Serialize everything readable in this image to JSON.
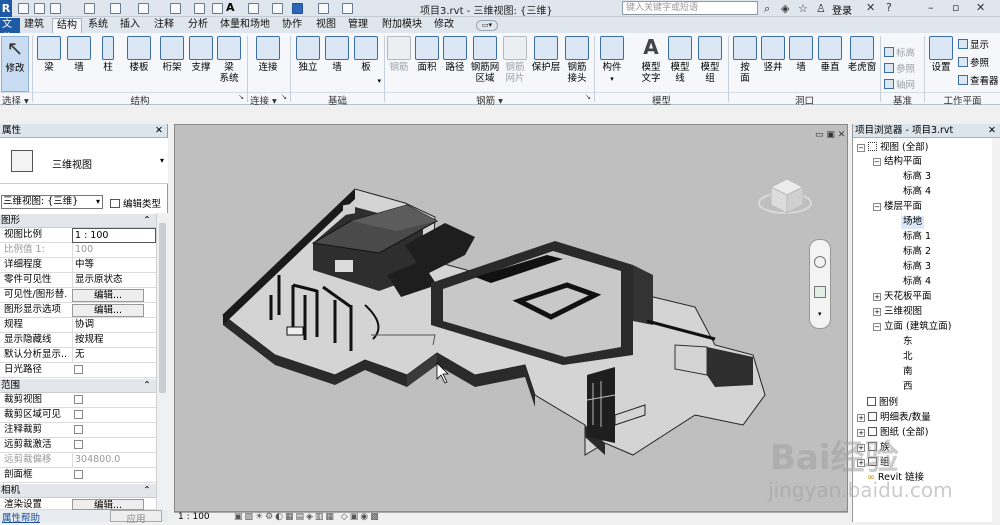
{
  "window": {
    "title": "项目3.rvt - 三维视图: {三维}",
    "search_placeholder": "键入关键字或短语",
    "login": "登录"
  },
  "tabs": [
    {
      "label": "文件"
    },
    {
      "label": "建筑"
    },
    {
      "label": "结构"
    },
    {
      "label": "系统"
    },
    {
      "label": "插入"
    },
    {
      "label": "注释"
    },
    {
      "label": "分析"
    },
    {
      "label": "体量和场地"
    },
    {
      "label": "协作"
    },
    {
      "label": "视图"
    },
    {
      "label": "管理"
    },
    {
      "label": "附加模块"
    },
    {
      "label": "修改"
    }
  ],
  "ribbon": {
    "buttons": [
      {
        "label": "修改",
        "icon": "cursor-arrow-icon"
      },
      {
        "label": "梁",
        "icon": "beam-icon"
      },
      {
        "label": "墙",
        "icon": "wall-icon"
      },
      {
        "label": "柱",
        "icon": "column-icon"
      },
      {
        "label": "楼板",
        "icon": "floor-icon"
      },
      {
        "label": "桁架",
        "icon": "truss-icon"
      },
      {
        "label": "支撑",
        "icon": "brace-icon"
      },
      {
        "label": "梁\n系统",
        "icon": "beam-system-icon"
      },
      {
        "label": "连接",
        "icon": "connection-icon"
      },
      {
        "label": "独立",
        "icon": "isolated-foundation-icon"
      },
      {
        "label": "墙",
        "icon": "wall-foundation-icon"
      },
      {
        "label": "板",
        "icon": "slab-foundation-icon"
      },
      {
        "label": "钢筋",
        "icon": "rebar-icon"
      },
      {
        "label": "面积",
        "icon": "area-rebar-icon"
      },
      {
        "label": "路径",
        "icon": "path-rebar-icon"
      },
      {
        "label": "钢筋网\n区域",
        "icon": "fabric-area-icon"
      },
      {
        "label": "钢筋\n网片",
        "icon": "fabric-sheet-icon"
      },
      {
        "label": "保护层",
        "icon": "cover-icon"
      },
      {
        "label": "钢筋\n接头",
        "icon": "rebar-coupler-icon"
      },
      {
        "label": "构件",
        "icon": "component-icon"
      },
      {
        "label": "模型\n文字",
        "icon": "model-text-icon"
      },
      {
        "label": "模型\n线",
        "icon": "model-line-icon"
      },
      {
        "label": "模型\n组",
        "icon": "model-group-icon"
      },
      {
        "label": "按\n面",
        "icon": "by-face-icon"
      },
      {
        "label": "竖井",
        "icon": "shaft-icon"
      },
      {
        "label": "墙",
        "icon": "wall-opening-icon"
      },
      {
        "label": "垂直",
        "icon": "vertical-opening-icon"
      },
      {
        "label": "老虎窗",
        "icon": "dormer-icon"
      },
      {
        "label": "设置",
        "icon": "set-workplane-icon"
      }
    ],
    "small": [
      {
        "label": "标高",
        "icon": "level-icon"
      },
      {
        "label": "参照",
        "icon": "reference-plane-icon"
      },
      {
        "label": "轴网",
        "icon": "grid-icon"
      },
      {
        "label": "显示",
        "icon": "show-icon"
      },
      {
        "label": "参照",
        "icon": "ref-plane-icon"
      },
      {
        "label": "查看器",
        "icon": "viewer-icon"
      }
    ],
    "groups": [
      {
        "label": "选择"
      },
      {
        "label": "结构"
      },
      {
        "label": "连接"
      },
      {
        "label": "基础"
      },
      {
        "label": "钢筋"
      },
      {
        "label": "模型"
      },
      {
        "label": "洞口"
      },
      {
        "label": "基准"
      },
      {
        "label": "工作平面"
      }
    ]
  },
  "properties": {
    "header": "属性",
    "type_name": "三维视图",
    "selector": "三维视图: {三维}",
    "edit_type": "编辑类型",
    "categories": [
      {
        "label": "图形",
        "toggle": "⌃"
      },
      {
        "label": "范围",
        "toggle": "⌃"
      },
      {
        "label": "相机",
        "toggle": "⌃"
      }
    ],
    "rows": [
      {
        "key": "视图比例",
        "value": "1 : 100"
      },
      {
        "key": "比例值 1:",
        "value": "100"
      },
      {
        "key": "详细程度",
        "value": "中等"
      },
      {
        "key": "零件可见性",
        "value": "显示原状态"
      },
      {
        "key": "可见性/图形替...",
        "value": "编辑..."
      },
      {
        "key": "图形显示选项",
        "value": "编辑..."
      },
      {
        "key": "规程",
        "value": "协调"
      },
      {
        "key": "显示隐藏线",
        "value": "按规程"
      },
      {
        "key": "默认分析显示...",
        "value": "无"
      },
      {
        "key": "日光路径",
        "value": ""
      },
      {
        "key": "裁剪视图",
        "value": ""
      },
      {
        "key": "裁剪区域可见",
        "value": ""
      },
      {
        "key": "注释裁剪",
        "value": ""
      },
      {
        "key": "远剪裁激活",
        "value": ""
      },
      {
        "key": "远剪裁偏移",
        "value": "304800.0"
      },
      {
        "key": "剖面框",
        "value": ""
      },
      {
        "key": "渲染设置",
        "value": "编辑..."
      }
    ],
    "footer_help": "属性帮助",
    "footer_apply": "应用"
  },
  "view": {
    "scale": "1 : 100"
  },
  "browser": {
    "header": "项目浏览器 - 项目3.rvt",
    "nodes": [
      {
        "label": "视图 (全部)"
      },
      {
        "label": "结构平面"
      },
      {
        "label": "标高 3"
      },
      {
        "label": "标高 4"
      },
      {
        "label": "楼层平面"
      },
      {
        "label": "场地"
      },
      {
        "label": "标高 1"
      },
      {
        "label": "标高 2"
      },
      {
        "label": "标高 3"
      },
      {
        "label": "标高 4"
      },
      {
        "label": "天花板平面"
      },
      {
        "label": "三维视图"
      },
      {
        "label": "立面 (建筑立面)"
      },
      {
        "label": "东"
      },
      {
        "label": "北"
      },
      {
        "label": "南"
      },
      {
        "label": "西"
      },
      {
        "label": "图例"
      },
      {
        "label": "明细表/数量"
      },
      {
        "label": "图纸 (全部)"
      },
      {
        "label": "族"
      },
      {
        "label": "组"
      },
      {
        "label": "Revit 链接"
      }
    ]
  },
  "watermark": {
    "line1": "Bai经验",
    "line2": "jingyan.baidu.com"
  },
  "colors": {
    "accent": "#1f5aa6",
    "ribbon": "#f5f7fa",
    "viewport": "#bfbfbf"
  }
}
